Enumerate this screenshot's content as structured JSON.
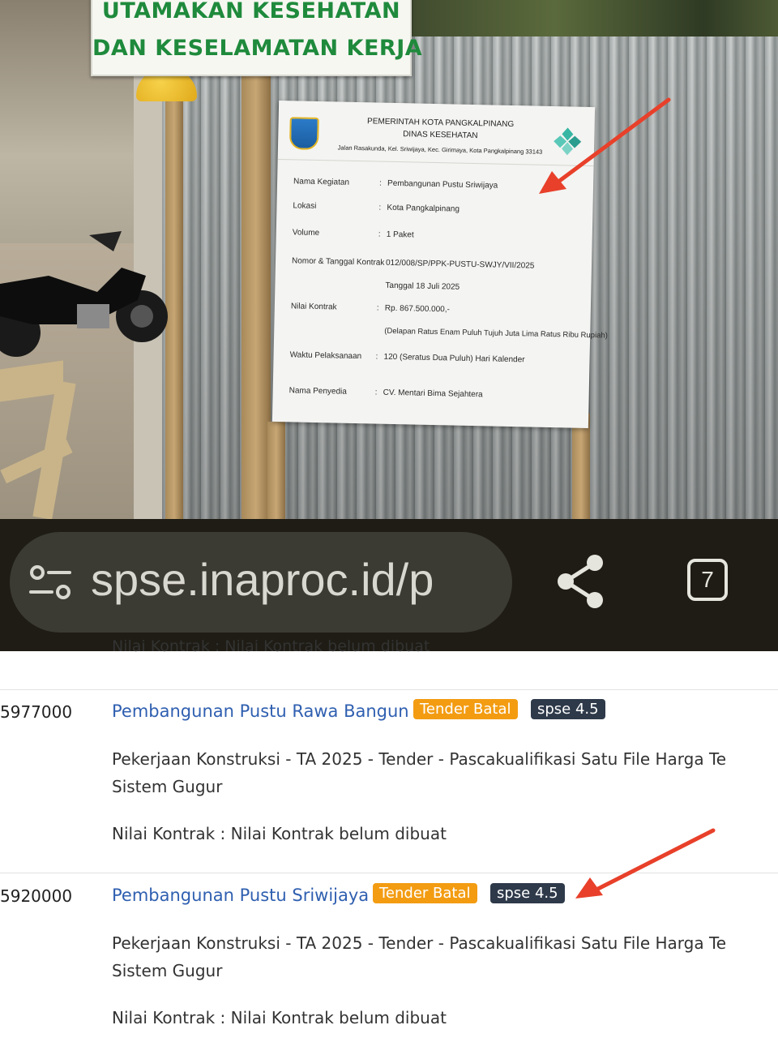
{
  "k3_sign": {
    "line1": "UTAMAKAN KESEHATAN",
    "line2": "DAN KESELAMATAN KERJA"
  },
  "project_banner": {
    "header_line1": "PEMERINTAH KOTA PANGKALPINANG",
    "header_line2": "DINAS KESEHATAN",
    "address": "Jalan Rasakunda, Kel. Sriwijaya, Kec. Girimaya, Kota Pangkalpinang 33143",
    "rows": [
      {
        "label": "Nama Kegiatan",
        "value": "Pembangunan Pustu Sriwijaya"
      },
      {
        "label": "Lokasi",
        "value": "Kota Pangkalpinang"
      },
      {
        "label": "Volume",
        "value": "1 Paket"
      },
      {
        "label": "Nomor & Tanggal Kontrak",
        "value": "012/008/SP/PPK-PUSTU-SWJY/VII/2025"
      },
      {
        "label": "Nilai Kontrak",
        "value": "Rp. 867.500.000,-"
      },
      {
        "label": "Waktu Pelaksanaan",
        "value": "120 (Seratus Dua Puluh) Hari Kalender"
      },
      {
        "label": "Nama Penyedia",
        "value": "CV. Mentari Bima Sejahtera"
      }
    ],
    "contract_date": "Tanggal 18 Juli 2025",
    "contract_value_words": "(Delapan Ratus Enam Puluh Tujuh Juta Lima Ratus Ribu Rupiah)",
    "colon": ":"
  },
  "browser": {
    "url": "spse.inaproc.id/p",
    "tab_count": "7",
    "icons": [
      "tune-icon",
      "share-icon",
      "tabs-icon"
    ]
  },
  "listing": {
    "peek_text": "Nilai Kontrak : Nilai Kontrak belum dibuat",
    "items": [
      {
        "id": "5977000",
        "title": "Pembangunan Pustu Rawa Bangun",
        "status_badge": "Tender Batal",
        "version_badge": "spse 4.5",
        "desc_line1": "Pekerjaan Konstruksi - TA 2025 - Tender - Pascakualifikasi Satu File Harga Te",
        "desc_line2": "Sistem Gugur",
        "nilai": "Nilai Kontrak : Nilai Kontrak belum dibuat"
      },
      {
        "id": "5920000",
        "title": "Pembangunan Pustu Sriwijaya",
        "status_badge": "Tender Batal",
        "version_badge": "spse 4.5",
        "desc_line1": "Pekerjaan Konstruksi - TA 2025 - Tender - Pascakualifikasi Satu File Harga Te",
        "desc_line2": "Sistem Gugur",
        "nilai": "Nilai Kontrak : Nilai Kontrak belum dibuat"
      }
    ]
  },
  "colors": {
    "title_link": "#2f5fb0",
    "badge_batal": "#f39c12",
    "badge_spse": "#2e3a4a",
    "arrow": "#e8402a",
    "sign_green": "#1f8a3c"
  }
}
